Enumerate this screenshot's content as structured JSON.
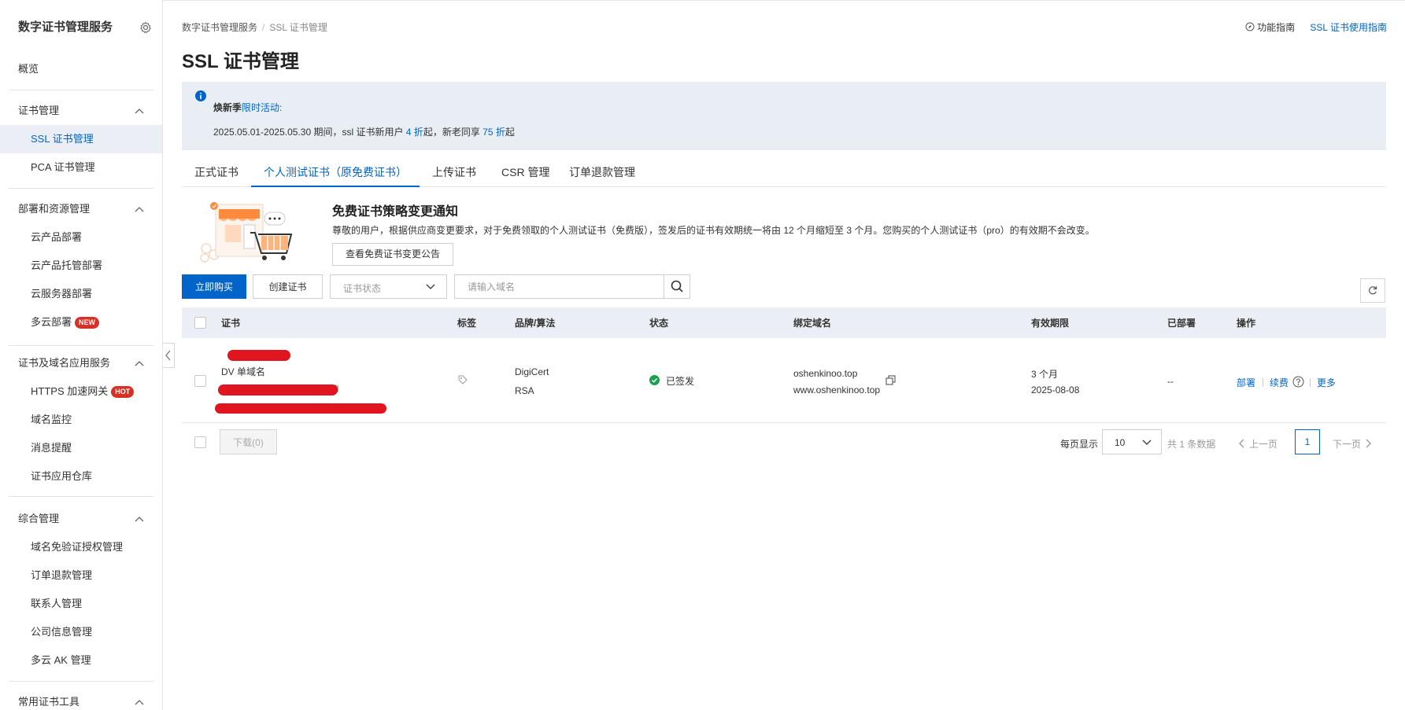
{
  "colors": {
    "primary": "#0064c8",
    "accent": "#ff6a00",
    "danger": "#d93026",
    "success": "#1aa051",
    "header_bg": "#ebeff5"
  },
  "sidebar": {
    "title": "数字证书管理服务",
    "overview": "概览",
    "groups": [
      {
        "label": "证书管理",
        "items": [
          "SSL 证书管理",
          "PCA 证书管理"
        ]
      },
      {
        "label": "部署和资源管理",
        "items": [
          "云产品部署",
          "云产品托管部署",
          "云服务器部署",
          "多云部署"
        ]
      },
      {
        "label": "证书及域名应用服务",
        "items": [
          "HTTPS 加速网关",
          "域名监控",
          "消息提醒",
          "证书应用仓库"
        ]
      },
      {
        "label": "综合管理",
        "items": [
          "域名免验证授权管理",
          "订单退款管理",
          "联系人管理",
          "公司信息管理",
          "多云 AK 管理"
        ]
      },
      {
        "label": "常用证书工具",
        "items": []
      }
    ],
    "badges": {
      "new": "NEW",
      "hot": "HOT"
    }
  },
  "breadcrumb": {
    "root": "数字证书管理服务",
    "sep": "/",
    "current": "SSL 证书管理"
  },
  "top_links": {
    "guide": "功能指南",
    "ssl_guide": "SSL 证书使用指南"
  },
  "page_title": "SSL 证书管理",
  "notice": {
    "line1_prefix": "焕新季",
    "line1_link": "限时活动:",
    "line2_a": "2025.05.01-2025.05.30 期间，ssl 证书新用户 ",
    "line2_hl1": "4 折",
    "line2_b": "起，新老同享 ",
    "line2_hl2": "75 折",
    "line2_c": "起"
  },
  "tabs": [
    "正式证书",
    "个人测试证书（原免费证书）",
    "上传证书",
    "CSR 管理",
    "订单退款管理"
  ],
  "promo": {
    "title": "免费证书策略变更通知",
    "text": "尊敬的用户，根据供应商变更要求，对于免费领取的个人测试证书（免费版），签发后的证书有效期统一将由 12 个月缩短至 3 个月。您购买的个人测试证书（pro）的有效期不会改变。",
    "button": "查看免费证书变更公告"
  },
  "toolbar": {
    "buy": "立即购买",
    "create": "创建证书",
    "status_placeholder": "证书状态",
    "search_placeholder": "请输入域名"
  },
  "table": {
    "headers": [
      "证书",
      "标签",
      "品牌/算法",
      "状态",
      "绑定域名",
      "有效期限",
      "已部署",
      "操作"
    ],
    "rows": [
      {
        "cert_type": "DV 单域名",
        "brand": "DigiCert",
        "algo": "RSA",
        "status": "已签发",
        "domain1": "oshenkinoo.top",
        "domain2": "www.oshenkinoo.top",
        "validity": "3 个月",
        "expire": "2025-08-08",
        "deployed": "--",
        "ops": [
          "部署",
          "续费",
          "更多"
        ]
      }
    ]
  },
  "footer": {
    "download": "下载(0)",
    "per_page_label": "每页显示",
    "per_page": "10",
    "total": "共 1 条数据",
    "prev": "上一页",
    "current_page": "1",
    "next": "下一页"
  }
}
